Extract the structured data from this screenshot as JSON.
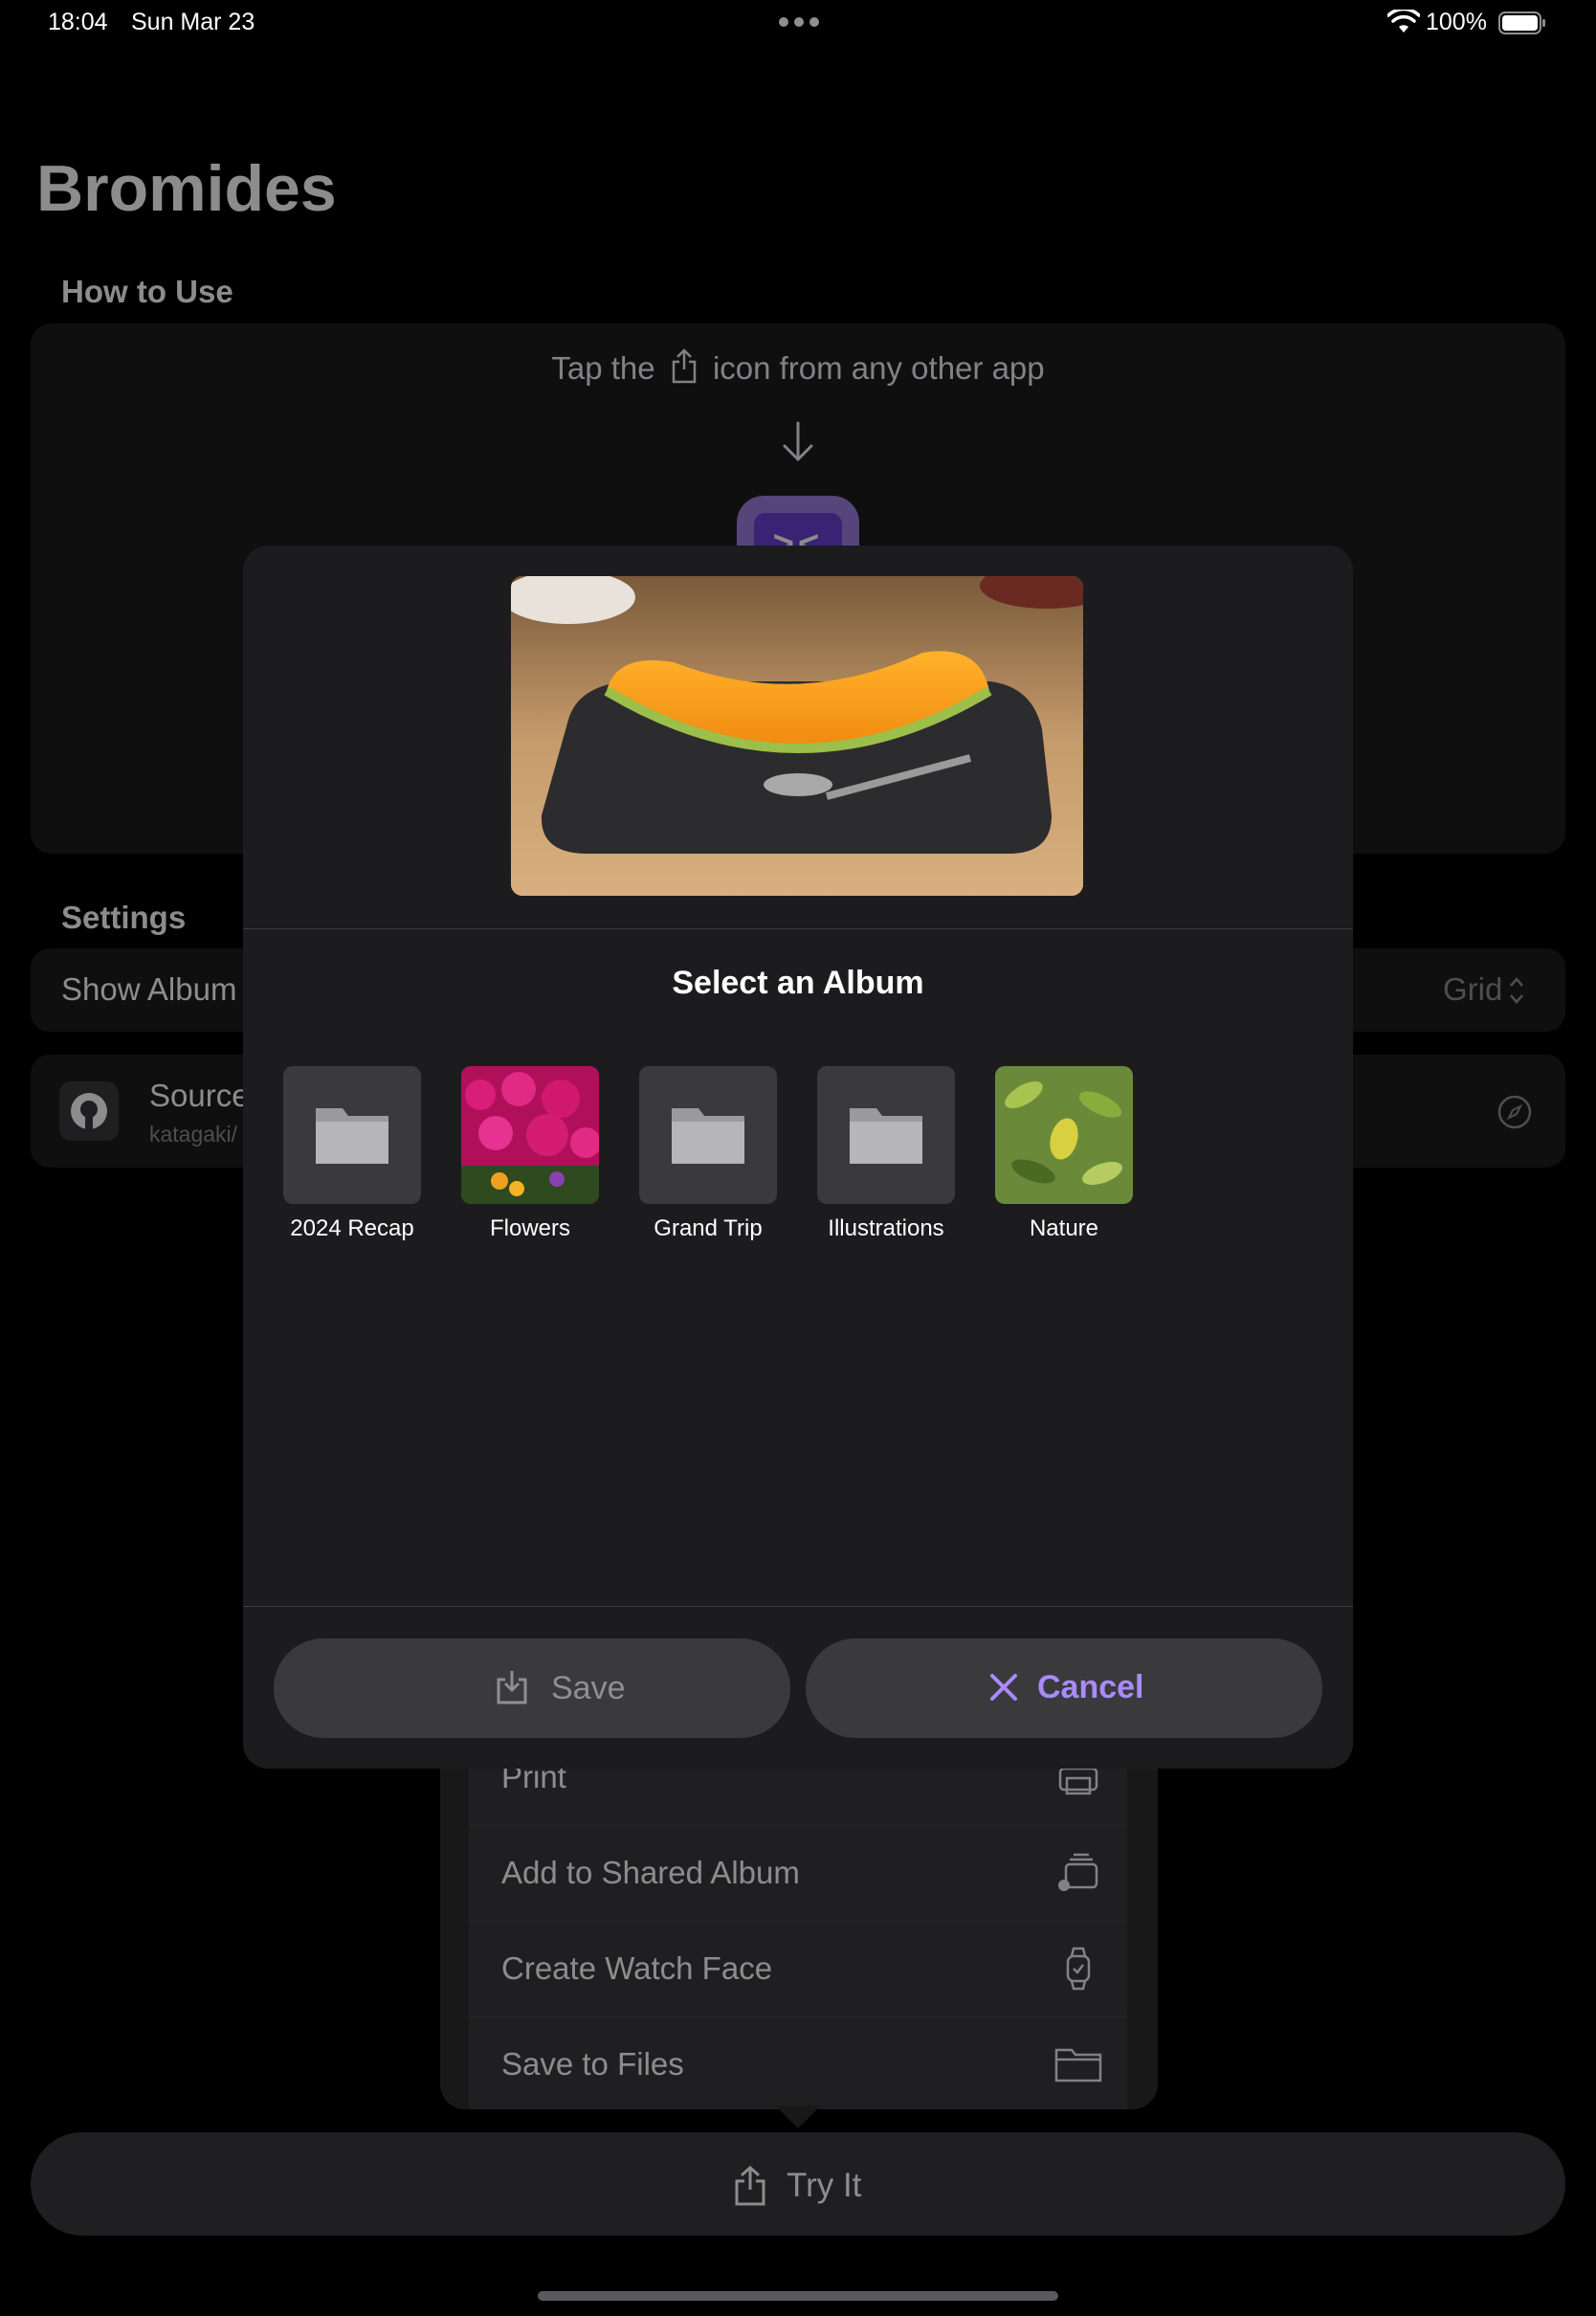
{
  "status_bar": {
    "time": "18:04",
    "date": "Sun Mar 23",
    "battery": "100%",
    "icons": [
      "wifi-icon",
      "battery-icon",
      "multitask-dots"
    ]
  },
  "app": {
    "title": "Bromides",
    "how_to_use": {
      "header": "How to Use",
      "instruction_before": "Tap the",
      "instruction_after": "icon from any other app"
    },
    "settings": {
      "header": "Settings",
      "show_album_label": "Show Album",
      "show_album_value": "Grid"
    },
    "source": {
      "title": "Source",
      "subtitle": "katagaki/"
    },
    "share_menu": {
      "items": [
        {
          "label": "Print",
          "icon": "printer-icon"
        },
        {
          "label": "Add to Shared Album",
          "icon": "shared-album-icon"
        },
        {
          "label": "Create Watch Face",
          "icon": "watch-icon"
        },
        {
          "label": "Save to Files",
          "icon": "folder-icon"
        }
      ]
    },
    "try_button": "Try It"
  },
  "sheet": {
    "title": "Select an Album",
    "albums": [
      {
        "name": "2024 Recap",
        "thumb": "folder-icon"
      },
      {
        "name": "Flowers",
        "thumb": "photo"
      },
      {
        "name": "Grand Trip",
        "thumb": "folder-icon"
      },
      {
        "name": "Illustrations",
        "thumb": "folder-icon"
      },
      {
        "name": "Nature",
        "thumb": "photo"
      }
    ],
    "save_label": "Save",
    "cancel_label": "Cancel"
  },
  "colors": {
    "accent": "#a98bff",
    "sheet_bg": "#1c1c1e",
    "button_bg": "#3a3a3c"
  }
}
